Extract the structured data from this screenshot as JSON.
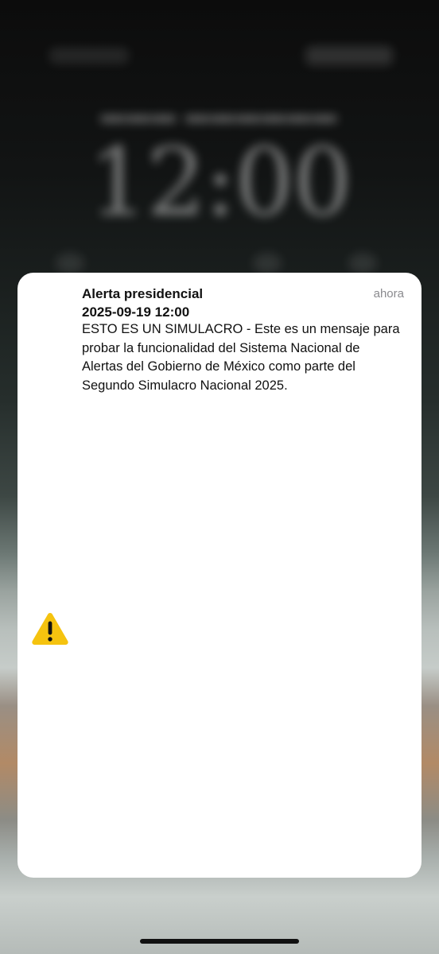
{
  "lock_screen": {
    "time": "12:00"
  },
  "notification": {
    "title": "Alerta presidencial",
    "datetime": "2025-09-19 12:00",
    "time_label": "ahora",
    "body": "ESTO ES UN SIMULACRO - Este es un mensaje para probar la funcionalidad del Sistema Nacional de Alertas del Gobierno de México como parte del Segundo Simulacro Nacional 2025.",
    "icon": "warning-triangle-icon",
    "icon_color": "#F5C30F"
  }
}
